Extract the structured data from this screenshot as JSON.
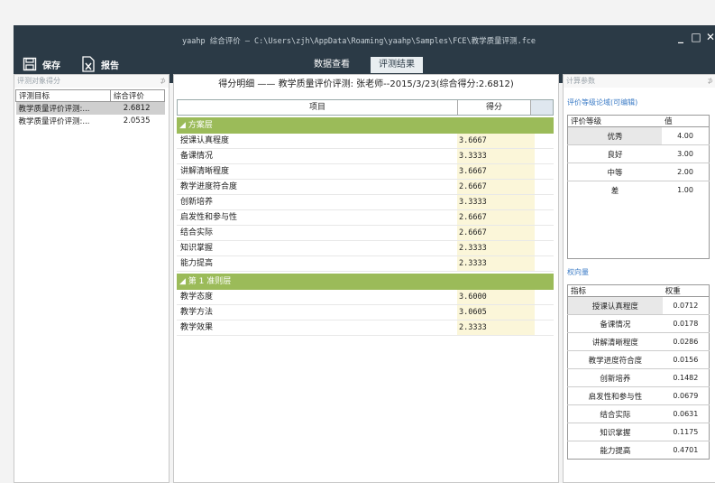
{
  "window": {
    "title": "yaahp 综合评价 — C:\\Users\\zjh\\AppData\\Roaming\\yaahp\\Samples\\FCE\\教学质量评测.fce",
    "minimize": "_",
    "maximize": "□",
    "close": "✕"
  },
  "toolbar": {
    "save_label": "保存",
    "report_label": "报告"
  },
  "tabs": [
    {
      "label": "数据查看",
      "active": false
    },
    {
      "label": "评测结果",
      "active": true
    }
  ],
  "left_panel": {
    "header": "评测对象得分",
    "pin": "⊅",
    "columns": [
      "评测目标",
      "综合评价"
    ],
    "rows": [
      {
        "name": "教学质量评价评测:...",
        "value": "2.6812"
      },
      {
        "name": "教学质量评价评测:...",
        "value": "2.0535"
      }
    ]
  },
  "center_panel": {
    "title": "得分明细 —— 教学质量评价评测: 张老师--2015/3/23(综合得分:2.6812)",
    "columns": [
      "项目",
      "得分"
    ],
    "groups": [
      {
        "label": "◢ 方案层",
        "rows": [
          {
            "name": "授课认真程度",
            "score": "3.6667"
          },
          {
            "name": "备课情况",
            "score": "3.3333"
          },
          {
            "name": "讲解清晰程度",
            "score": "3.6667"
          },
          {
            "name": "教学进度符合度",
            "score": "2.6667"
          },
          {
            "name": "创新培养",
            "score": "3.3333"
          },
          {
            "name": "启发性和参与性",
            "score": "2.6667"
          },
          {
            "name": "结合实际",
            "score": "2.6667"
          },
          {
            "name": "知识掌握",
            "score": "2.3333"
          },
          {
            "name": "能力提高",
            "score": "2.3333"
          }
        ]
      },
      {
        "label": "◢ 第 1 准则层",
        "rows": [
          {
            "name": "教学态度",
            "score": "3.6000"
          },
          {
            "name": "教学方法",
            "score": "3.0605"
          },
          {
            "name": "教学效果",
            "score": "2.3333"
          }
        ]
      }
    ]
  },
  "right_panel": {
    "header": "计算参数",
    "pin": "⊅",
    "grade_section": "评价等级论域(可编辑)",
    "grade_columns": [
      "评价等级",
      "值"
    ],
    "grades": [
      {
        "name": "优秀",
        "value": "4.00"
      },
      {
        "name": "良好",
        "value": "3.00"
      },
      {
        "name": "中等",
        "value": "2.00"
      },
      {
        "name": "差",
        "value": "1.00"
      }
    ],
    "weight_section": "权向量",
    "weight_columns": [
      "指标",
      "权重"
    ],
    "weights": [
      {
        "name": "授课认真程度",
        "value": "0.0712"
      },
      {
        "name": "备课情况",
        "value": "0.0178"
      },
      {
        "name": "讲解清晰程度",
        "value": "0.0286"
      },
      {
        "name": "教学进度符合度",
        "value": "0.0156"
      },
      {
        "name": "创新培养",
        "value": "0.1482"
      },
      {
        "name": "启发性和参与性",
        "value": "0.0679"
      },
      {
        "name": "结合实际",
        "value": "0.0631"
      },
      {
        "name": "知识掌握",
        "value": "0.1175"
      },
      {
        "name": "能力提高",
        "value": "0.4701"
      }
    ]
  },
  "colors": {
    "titlebar": "#2b3a46",
    "group_row": "#9bbb59",
    "score_cell": "#fbf6d9",
    "link_text": "#3b7bc6"
  }
}
